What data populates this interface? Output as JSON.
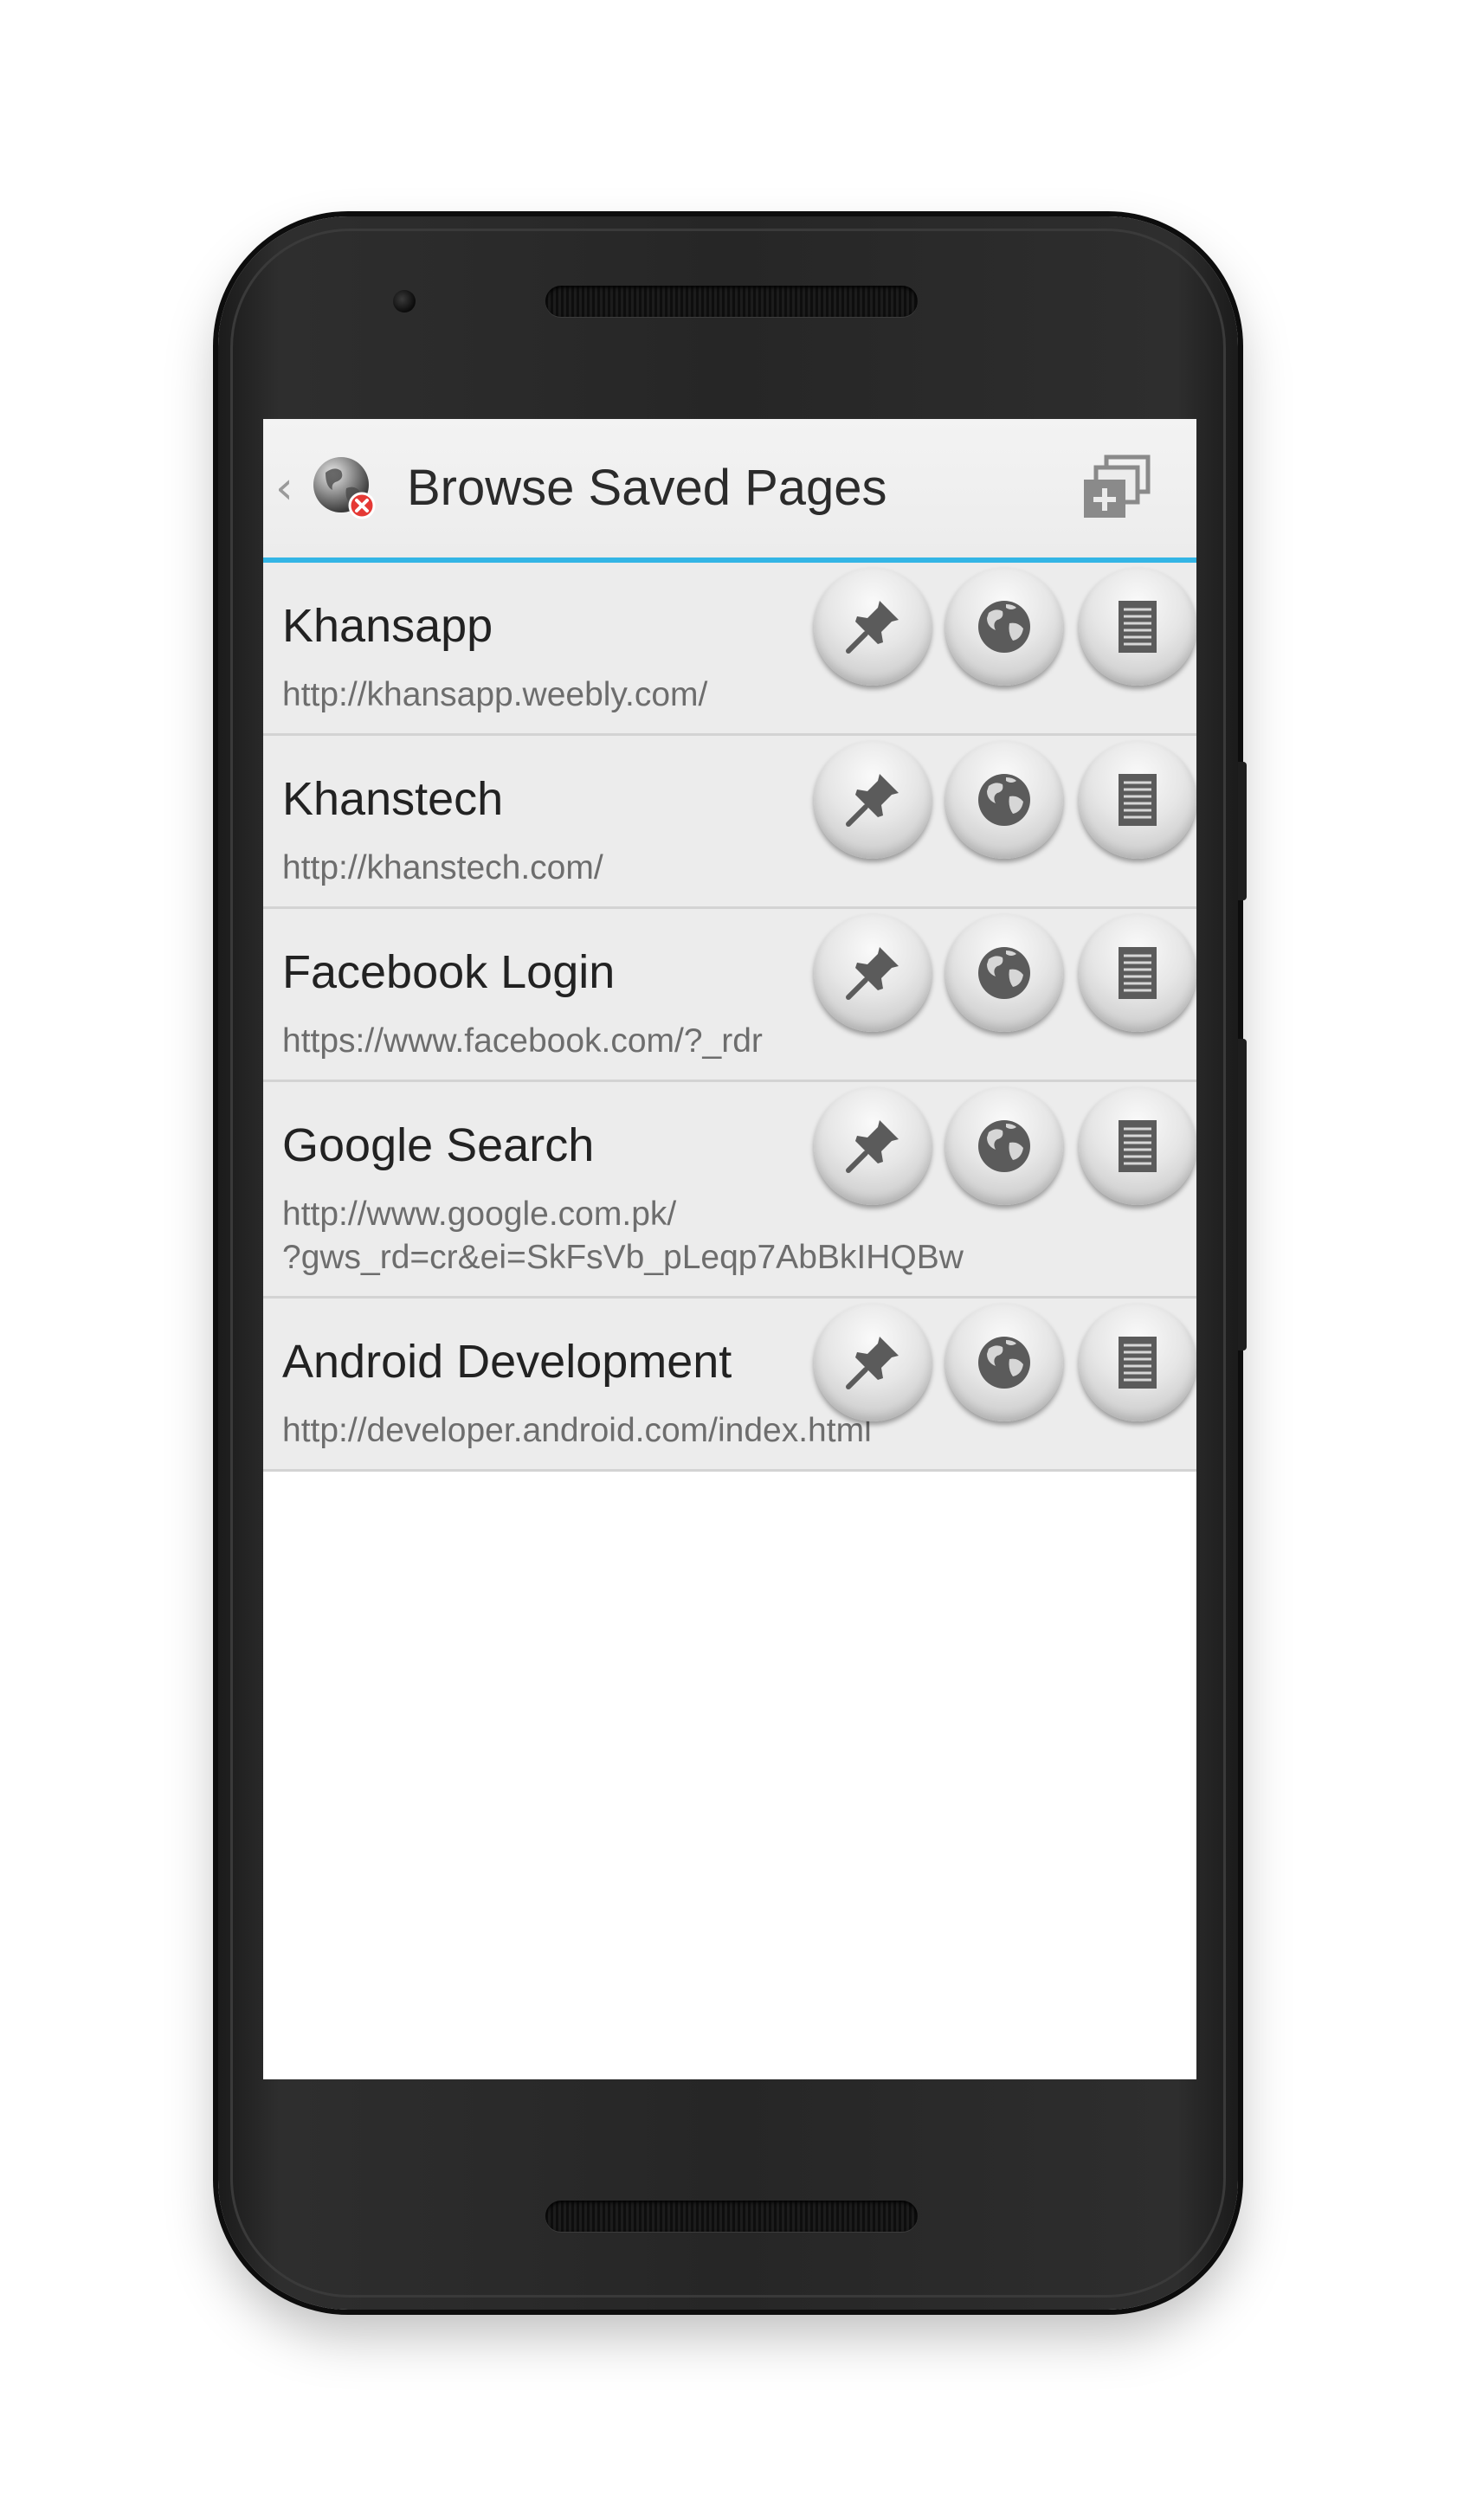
{
  "actionbar": {
    "title": "Browse Saved Pages",
    "back_icon": "chevron-left-icon",
    "app_icon": "globe-with-error-badge-icon",
    "action_icon": "new-window-icon",
    "accent_color": "#33b5e5"
  },
  "pages": [
    {
      "title": "Khansapp",
      "url": "http://khansapp.weebly.com/"
    },
    {
      "title": "Khanstech",
      "url": "http://khanstech.com/"
    },
    {
      "title": "Facebook Login",
      "url": "https://www.facebook.com/?_rdr"
    },
    {
      "title": "Google Search",
      "url": "http://www.google.com.pk/\n?gws_rd=cr&ei=SkFsVb_pLeqp7AbBkIHQBw"
    },
    {
      "title": "Android Development",
      "url": "http://developer.android.com/index.html"
    }
  ],
  "row_actions": [
    "pin-icon",
    "globe-icon",
    "document-icon"
  ]
}
